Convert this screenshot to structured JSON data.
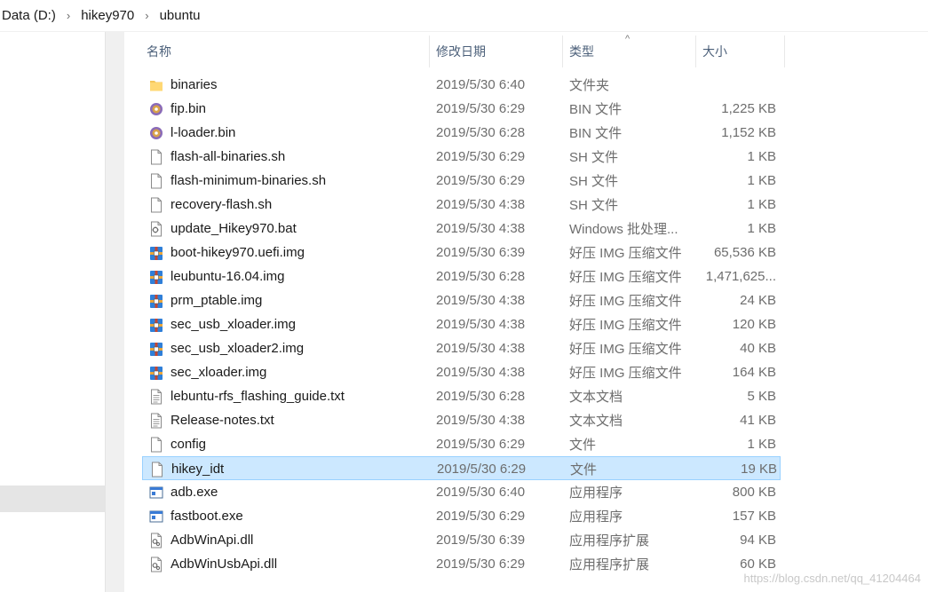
{
  "breadcrumb": {
    "items": [
      "Data (D:)",
      "hikey970",
      "ubuntu"
    ],
    "separator": "›"
  },
  "columns": {
    "name": "名称",
    "date": "修改日期",
    "type": "类型",
    "size": "大小",
    "sort_indicator": "^"
  },
  "files": [
    {
      "icon": "folder-icon",
      "name": "binaries",
      "date": "2019/5/30 6:40",
      "type": "文件夹",
      "size": ""
    },
    {
      "icon": "disc-image-icon",
      "name": "fip.bin",
      "date": "2019/5/30 6:29",
      "type": "BIN 文件",
      "size": "1,225 KB"
    },
    {
      "icon": "disc-image-icon",
      "name": "l-loader.bin",
      "date": "2019/5/30 6:28",
      "type": "BIN 文件",
      "size": "1,152 KB"
    },
    {
      "icon": "blank-file-icon",
      "name": "flash-all-binaries.sh",
      "date": "2019/5/30 6:29",
      "type": "SH 文件",
      "size": "1 KB"
    },
    {
      "icon": "blank-file-icon",
      "name": "flash-minimum-binaries.sh",
      "date": "2019/5/30 6:29",
      "type": "SH 文件",
      "size": "1 KB"
    },
    {
      "icon": "blank-file-icon",
      "name": "recovery-flash.sh",
      "date": "2019/5/30 4:38",
      "type": "SH 文件",
      "size": "1 KB"
    },
    {
      "icon": "batch-file-icon",
      "name": "update_Hikey970.bat",
      "date": "2019/5/30 4:38",
      "type": "Windows 批处理...",
      "size": "1 KB"
    },
    {
      "icon": "archive-icon",
      "name": "boot-hikey970.uefi.img",
      "date": "2019/5/30 6:39",
      "type": "好压 IMG 压缩文件",
      "size": "65,536 KB"
    },
    {
      "icon": "archive-icon",
      "name": "leubuntu-16.04.img",
      "date": "2019/5/30 6:28",
      "type": "好压 IMG 压缩文件",
      "size": "1,471,625..."
    },
    {
      "icon": "archive-icon",
      "name": "prm_ptable.img",
      "date": "2019/5/30 4:38",
      "type": "好压 IMG 压缩文件",
      "size": "24 KB"
    },
    {
      "icon": "archive-icon",
      "name": "sec_usb_xloader.img",
      "date": "2019/5/30 4:38",
      "type": "好压 IMG 压缩文件",
      "size": "120 KB"
    },
    {
      "icon": "archive-icon",
      "name": "sec_usb_xloader2.img",
      "date": "2019/5/30 4:38",
      "type": "好压 IMG 压缩文件",
      "size": "40 KB"
    },
    {
      "icon": "archive-icon",
      "name": "sec_xloader.img",
      "date": "2019/5/30 4:38",
      "type": "好压 IMG 压缩文件",
      "size": "164 KB"
    },
    {
      "icon": "text-file-icon",
      "name": "lebuntu-rfs_flashing_guide.txt",
      "date": "2019/5/30 6:28",
      "type": "文本文档",
      "size": "5 KB"
    },
    {
      "icon": "text-file-icon",
      "name": "Release-notes.txt",
      "date": "2019/5/30 4:38",
      "type": "文本文档",
      "size": "41 KB"
    },
    {
      "icon": "blank-file-icon",
      "name": "config",
      "date": "2019/5/30 6:29",
      "type": "文件",
      "size": "1 KB"
    },
    {
      "icon": "blank-file-icon",
      "name": "hikey_idt",
      "date": "2019/5/30 6:29",
      "type": "文件",
      "size": "19 KB",
      "selected": true
    },
    {
      "icon": "exe-icon",
      "name": "adb.exe",
      "date": "2019/5/30 6:40",
      "type": "应用程序",
      "size": "800 KB"
    },
    {
      "icon": "exe-icon",
      "name": "fastboot.exe",
      "date": "2019/5/30 6:29",
      "type": "应用程序",
      "size": "157 KB"
    },
    {
      "icon": "dll-icon",
      "name": "AdbWinApi.dll",
      "date": "2019/5/30 6:39",
      "type": "应用程序扩展",
      "size": "94 KB"
    },
    {
      "icon": "dll-icon",
      "name": "AdbWinUsbApi.dll",
      "date": "2019/5/30 6:29",
      "type": "应用程序扩展",
      "size": "60 KB"
    }
  ],
  "watermark": "https://blog.csdn.net/qq_41204464",
  "colors": {
    "selected_row": "#cce8ff",
    "selected_border": "#99d1ff",
    "header_text": "#4c607a",
    "muted_text": "#6d6d6d"
  }
}
